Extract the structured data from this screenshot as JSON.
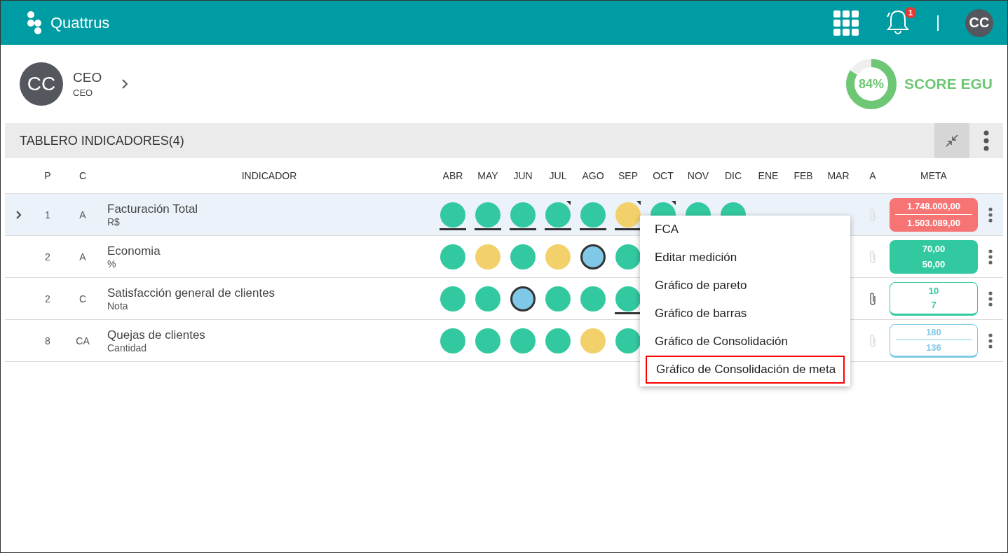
{
  "app": {
    "logo": "Quattrus",
    "notifications": "1",
    "avatar": "CC"
  },
  "profile": {
    "avatar": "CC",
    "name": "CEO",
    "role": "CEO"
  },
  "score": {
    "value": "84%",
    "level": 0.84,
    "label": "SCORE EGU"
  },
  "board": {
    "title": "TABLERO INDICADORES(4)"
  },
  "columns": {
    "p": "P",
    "c": "C",
    "indicator": "INDICADOR",
    "months": [
      "ABR",
      "MAY",
      "JUN",
      "JUL",
      "AGO",
      "SEP",
      "OCT",
      "NOV",
      "DIC",
      "ENE",
      "FEB",
      "MAR"
    ],
    "a": "A",
    "meta": "META"
  },
  "rows": [
    {
      "selected": true,
      "p": "1",
      "c": "A",
      "name": "Facturación Total",
      "unit": "R$",
      "attachment": false,
      "meta": {
        "kind": "filled-red",
        "target": "1.748.000,00",
        "actual": "1.503.089,00"
      },
      "months": [
        {
          "color": "#33c9a0",
          "outlined": false,
          "underline": true,
          "flag": false
        },
        {
          "color": "#33c9a0",
          "outlined": false,
          "underline": true,
          "flag": false
        },
        {
          "color": "#33c9a0",
          "outlined": false,
          "underline": true,
          "flag": false
        },
        {
          "color": "#33c9a0",
          "outlined": false,
          "underline": true,
          "flag": true
        },
        {
          "color": "#33c9a0",
          "outlined": false,
          "underline": true,
          "flag": false
        },
        {
          "color": "#f2d16b",
          "outlined": false,
          "underline": true,
          "flag": true
        },
        {
          "color": "#33c9a0",
          "outlined": false,
          "underline": false,
          "flag": true
        },
        {
          "color": "#33c9a0",
          "outlined": false,
          "flag": false
        },
        {
          "color": "#33c9a0",
          "outlined": false,
          "flag": false
        }
      ]
    },
    {
      "selected": false,
      "p": "2",
      "c": "A",
      "name": "Economia",
      "unit": "%",
      "attachment": false,
      "meta": {
        "kind": "filled-green",
        "target": "70,00",
        "actual": "50,00"
      },
      "months": [
        {
          "color": "#33c9a0",
          "outlined": false,
          "underline": false,
          "flag": false
        },
        {
          "color": "#f2d16b",
          "outlined": false,
          "underline": false,
          "flag": false
        },
        {
          "color": "#33c9a0",
          "outlined": false,
          "underline": false,
          "flag": false
        },
        {
          "color": "#f2d16b",
          "outlined": false,
          "underline": false,
          "flag": false
        },
        {
          "color": "#7fc8e8",
          "outlined": true,
          "underline": false,
          "flag": false
        },
        {
          "color": "#33c9a0",
          "outlined": false,
          "underline": false,
          "flag": false
        }
      ]
    },
    {
      "selected": false,
      "p": "2",
      "c": "C",
      "name": "Satisfacción general de clientes",
      "unit": "Nota",
      "attachment": true,
      "meta": {
        "kind": "outline-green",
        "target": "10",
        "actual": "7"
      },
      "months": [
        {
          "color": "#33c9a0",
          "outlined": false,
          "underline": false,
          "flag": false
        },
        {
          "color": "#33c9a0",
          "outlined": false,
          "underline": false,
          "flag": false
        },
        {
          "color": "#7fc8e8",
          "outlined": true,
          "underline": false,
          "flag": false
        },
        {
          "color": "#33c9a0",
          "outlined": false,
          "underline": false,
          "flag": false
        },
        {
          "color": "#33c9a0",
          "outlined": false,
          "underline": false,
          "flag": false
        },
        {
          "color": "#33c9a0",
          "outlined": false,
          "underline": true,
          "flag": false
        }
      ]
    },
    {
      "selected": false,
      "p": "8",
      "c": "CA",
      "name": "Quejas de clientes",
      "unit": "Cantidad",
      "attachment": false,
      "meta": {
        "kind": "outline-blue",
        "target": "180",
        "actual": "136"
      },
      "months": [
        {
          "color": "#33c9a0",
          "outlined": false,
          "underline": false,
          "flag": false
        },
        {
          "color": "#33c9a0",
          "outlined": false,
          "underline": false,
          "flag": false
        },
        {
          "color": "#33c9a0",
          "outlined": false,
          "underline": false,
          "flag": false
        },
        {
          "color": "#33c9a0",
          "outlined": false,
          "underline": false,
          "flag": false
        },
        {
          "color": "#f2d16b",
          "outlined": false,
          "underline": false,
          "flag": false
        },
        {
          "color": "#33c9a0",
          "outlined": false,
          "underline": false,
          "flag": false
        }
      ]
    }
  ],
  "context_menu": [
    {
      "label": "FCA",
      "selected": false
    },
    {
      "label": "Editar medición",
      "selected": false
    },
    {
      "label": "Gráfico de pareto",
      "selected": false
    },
    {
      "label": "Gráfico de barras",
      "selected": false
    },
    {
      "label": "Gráfico de Consolidación",
      "selected": false
    },
    {
      "label": "Gráfico de Consolidación de meta",
      "selected": true
    }
  ]
}
